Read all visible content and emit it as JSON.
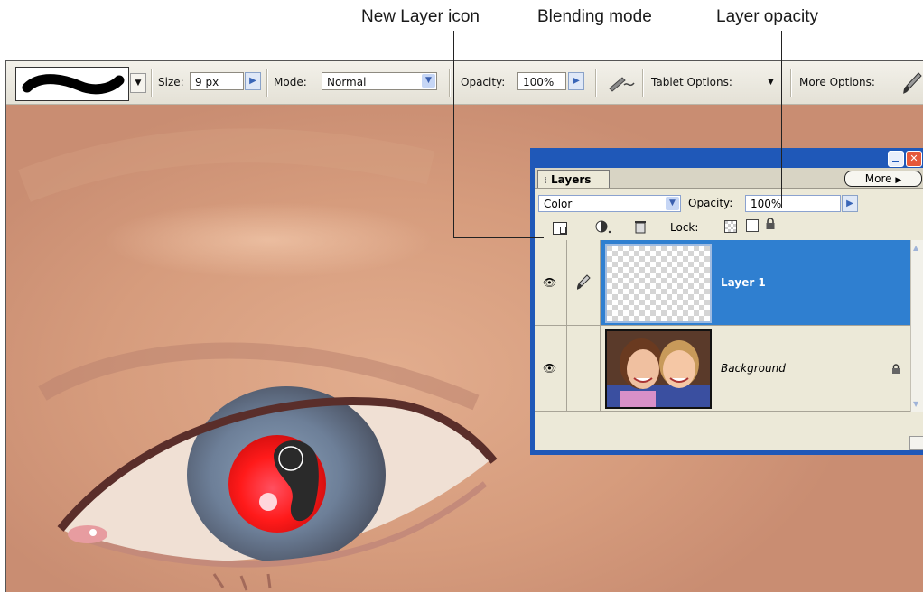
{
  "callouts": {
    "new_layer": "New Layer icon",
    "blending_mode": "Blending mode",
    "layer_opacity": "Layer opacity"
  },
  "options_bar": {
    "size_label": "Size:",
    "size_value": "9 px",
    "mode_label": "Mode:",
    "mode_value": "Normal",
    "opacity_label": "Opacity:",
    "opacity_value": "100%",
    "tablet_options": "Tablet Options:",
    "more_options": "More Options:"
  },
  "layers_panel": {
    "tab_label": "Layers",
    "more_button": "More",
    "blend_mode": "Color",
    "opacity_label": "Opacity:",
    "opacity_value": "100%",
    "lock_label": "Lock:",
    "layers": [
      {
        "name": "Layer 1",
        "selected": true
      },
      {
        "name": "Background",
        "selected": false,
        "locked": true
      }
    ]
  },
  "colors": {
    "selection": "#2f7fd0",
    "panel_title": "#1f58b8",
    "red_eye": "#ff1a1a"
  }
}
